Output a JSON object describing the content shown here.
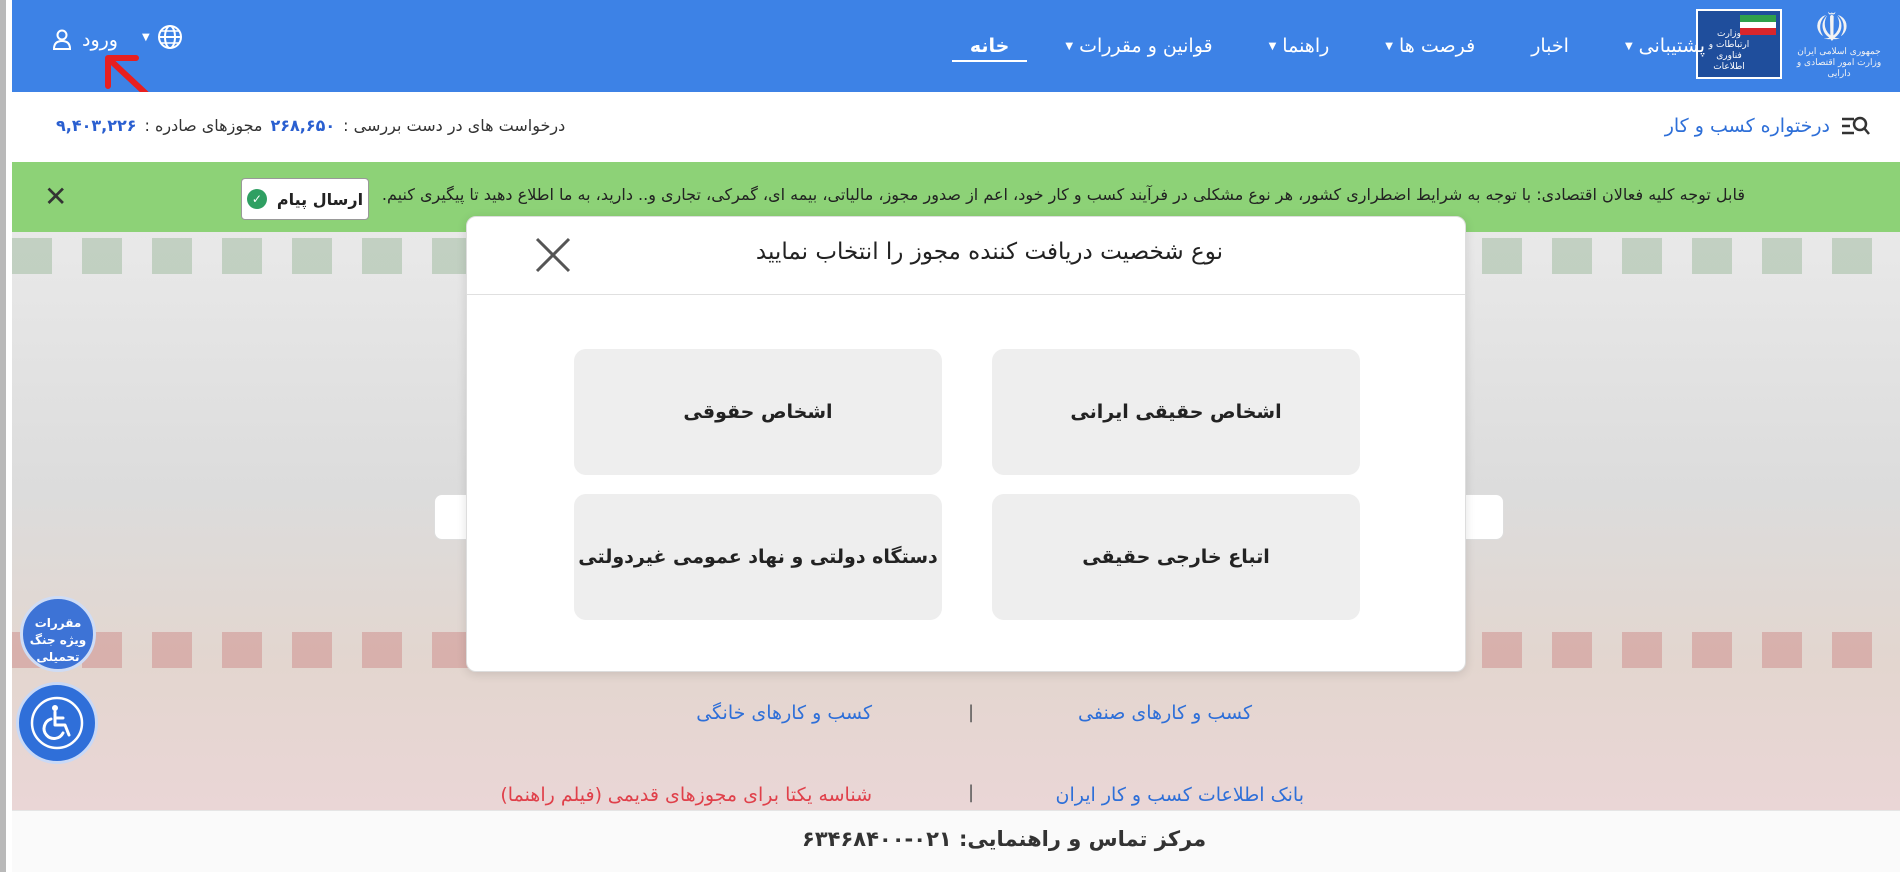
{
  "header": {
    "nav": [
      {
        "label": "خانه",
        "has_caret": false,
        "active": true
      },
      {
        "label": "قوانین و مقررات",
        "has_caret": true
      },
      {
        "label": "راهنما",
        "has_caret": true
      },
      {
        "label": "فرصت ها",
        "has_caret": true
      },
      {
        "label": "اخبار",
        "has_caret": false
      },
      {
        "label": "پشتیبانی",
        "has_caret": true
      }
    ],
    "login_label": "ورود",
    "seal_text": "جمهوری اسلامی ایران\nوزارت امور اقتصادی و دارایی",
    "ministry_text": "وزارت ارتباطات و فناوری اطلاعات",
    "brand_color": "#3d82e6"
  },
  "stats": {
    "pending_label": "درخواست های در دست بررسی :",
    "pending_value": "۲۶۸,۶۵۰",
    "issued_label": "مجوزهای صادره :",
    "issued_value": "۹,۴۰۳,۲۲۶"
  },
  "dashboard_label": "درختواره کسب و کار",
  "notice": {
    "text": "قابل توجه کلیه فعالان اقتصادی: با توجه به شرایط اضطراری کشور، هر نوع مشکلی در فرآیند کسب و کار خود، اعم از صدور مجوز، مالیاتی، بیمه ای، گمرکی، تجاری و.. دارید، به ما اطلاع دهید تا پیگیری کنیم.",
    "send_label": "ارسال پیام",
    "color": "#8dd277"
  },
  "modal": {
    "title": "نوع شخصیت دریافت کننده مجوز را انتخاب نمایید",
    "options": [
      "اشخاص حقیقی ایرانی",
      "اشخاص حقوقی",
      "اتباع خارجی حقیقی",
      "دستگاه دولتی و نهاد عمومی غیردولتی"
    ]
  },
  "links": {
    "guild": "کسب و کارهای صنفی",
    "home": "کسب و کارهای خانگی",
    "bank": "بانک اطلاعات کسب و کار ایران",
    "unique_id": "شناسه یکتا برای مجوزهای قدیمی",
    "video_guide": "(فیلم راهنما)"
  },
  "footer": {
    "contact": "مرکز تماس و راهنمایی: ۰۲۱-۶۳۴۶۸۴۰۰"
  },
  "floating": {
    "war_rules": "مقررات ویژه جنگ تحمیلی"
  }
}
